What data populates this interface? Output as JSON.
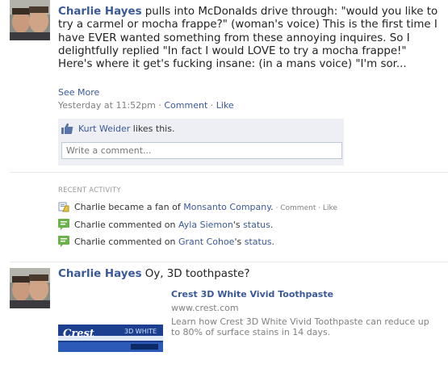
{
  "story1": {
    "name": "Charlie Hayes",
    "text": " pulls into McDonalds drive through: \"would you like to try a carmel or mocha frappe?\" (woman's voice) This is the first time I have EVER wanted something from these annoying inquires. So I delightfully replied \"In fact I would LOVE to try a mocha frappe!\" Here's where it get's fucking insane: (in a mans voice) \"I'm sor...",
    "see_more": "See More",
    "time": "Yesterday at 11:52pm",
    "sep": " · ",
    "comment": "Comment",
    "like": "Like",
    "liker": "Kurt Weider",
    "likes_text": " likes this.",
    "comment_placeholder": "Write a comment..."
  },
  "recent_activity": {
    "title": "RECENT ACTIVITY",
    "items": [
      {
        "icon": "fan-page-icon",
        "pre": "Charlie became a fan of ",
        "link": "Monsanto Company",
        "post": ".",
        "actions": " · Comment · Like"
      },
      {
        "icon": "comment-bubble-icon",
        "pre": "Charlie commented on ",
        "link": "Ayla Siemon",
        "mid": "'s ",
        "link2": "status",
        "post": "."
      },
      {
        "icon": "comment-bubble-icon",
        "pre": "Charlie commented on ",
        "link": "Grant Cohoe",
        "mid": "'s ",
        "link2": "status",
        "post": "."
      }
    ]
  },
  "story2": {
    "name": "Charlie Hayes",
    "text": " Oy, 3D toothpaste?",
    "ad_title": "Crest 3D White Vivid Toothpaste",
    "ad_url": "www.crest.com",
    "ad_desc": "Learn how Crest 3D White Vivid Toothpaste can reduce up to 80% of surface stains in 14 days.",
    "ad_brand": "Crest",
    "ad_product": "3D WHITE"
  },
  "colors": {
    "link": "#3b5998",
    "meta": "#808080",
    "like_box": "#edeff4"
  }
}
